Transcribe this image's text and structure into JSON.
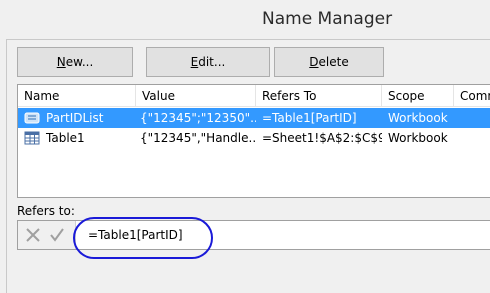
{
  "window": {
    "title": "Name Manager"
  },
  "toolbar": {
    "new_underline": "N",
    "new_rest": "ew...",
    "edit_underline": "E",
    "edit_rest": "dit...",
    "delete_underline": "D",
    "delete_rest": "elete"
  },
  "list": {
    "columns": [
      "Name",
      "Value",
      "Refers To",
      "Scope",
      "Comm"
    ],
    "rows": [
      {
        "name": "PartIDList",
        "value": "{\"12345\";\"12350\"...",
        "refers_to": "=Table1[PartID]",
        "scope": "Workbook",
        "icon": "named-range-icon",
        "selected": true
      },
      {
        "name": "Table1",
        "value": "{\"12345\",\"Handle...",
        "refers_to": "=Sheet1!$A$2:$C$9",
        "scope": "Workbook",
        "icon": "table-icon",
        "selected": false
      }
    ]
  },
  "refers": {
    "label": "Refers to:",
    "value": "=Table1[PartID]"
  },
  "colors": {
    "selection": "#3399ff",
    "highlight_oval": "#1a1ad8"
  }
}
